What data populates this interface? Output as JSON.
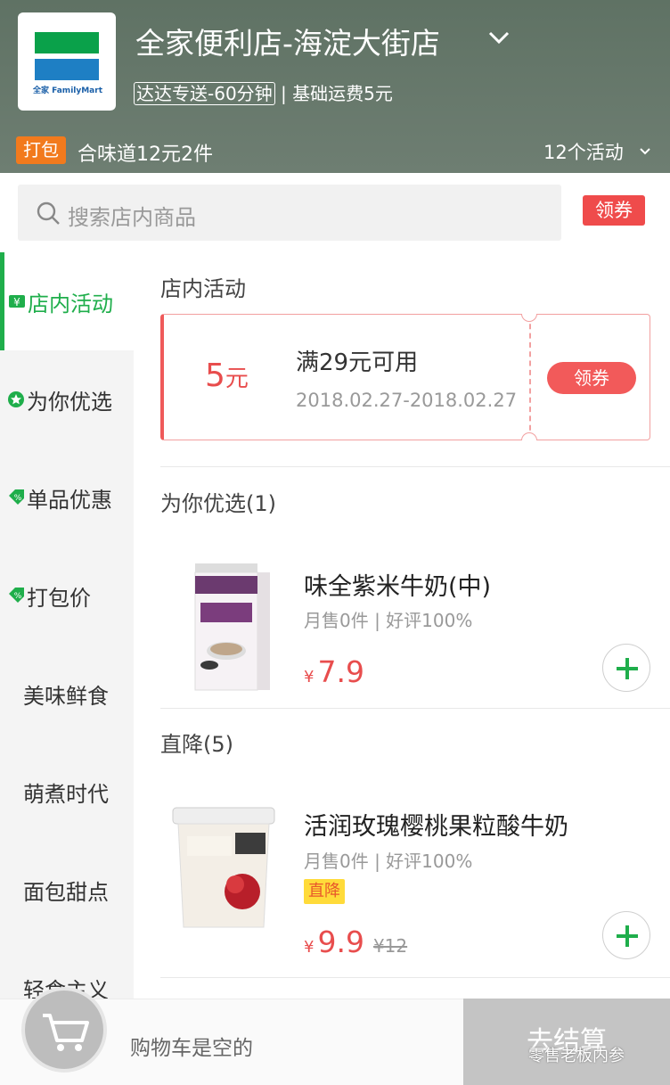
{
  "header": {
    "logo_text": "全家 FamilyMart",
    "store_name": "全家便利店-海淀大街店",
    "delivery_tag": "达达专送-60分钟",
    "separator": "|",
    "base_fee": "基础运费5元",
    "promo_badge": "打包",
    "promo_text": "合味道12元2件",
    "activity_count": "12个活动"
  },
  "search": {
    "placeholder": "搜索店内商品"
  },
  "coupon_button": "领券",
  "sidebar": {
    "items": [
      {
        "label": "店内活动",
        "icon": "yen-icon",
        "active": true
      },
      {
        "label": "为你优选",
        "icon": "star-badge-icon"
      },
      {
        "label": "单品优惠",
        "icon": "discount-tag-icon"
      },
      {
        "label": "打包价",
        "icon": "discount-tag-icon"
      },
      {
        "label": "美味鲜食"
      },
      {
        "label": "萌煮时代"
      },
      {
        "label": "面包甜点"
      },
      {
        "label": "轻食主义"
      }
    ]
  },
  "sections": {
    "store_activity": "店内活动",
    "for_you": "为你优选(1)",
    "price_drop": "直降(5)"
  },
  "coupon": {
    "amount": "5",
    "unit": "元",
    "condition": "满29元可用",
    "date_range": "2018.02.27-2018.02.27",
    "claim_label": "领券"
  },
  "products": [
    {
      "name": "味全紫米牛奶(中)",
      "meta": "月售0件 | 好评100%",
      "currency": "¥",
      "price": "7.9"
    },
    {
      "name": "活润玫瑰樱桃果粒酸牛奶",
      "meta": "月售0件 | 好评100%",
      "tag": "直降",
      "currency": "¥",
      "price": "9.9",
      "original_price": "¥12"
    }
  ],
  "cart": {
    "empty_text": "购物车是空的",
    "checkout_label": "去结算",
    "watermark": "零售老板内参"
  },
  "colors": {
    "accent_green": "#1fae4b",
    "price_red": "#e84d4d",
    "header_bg": "#66786b"
  }
}
